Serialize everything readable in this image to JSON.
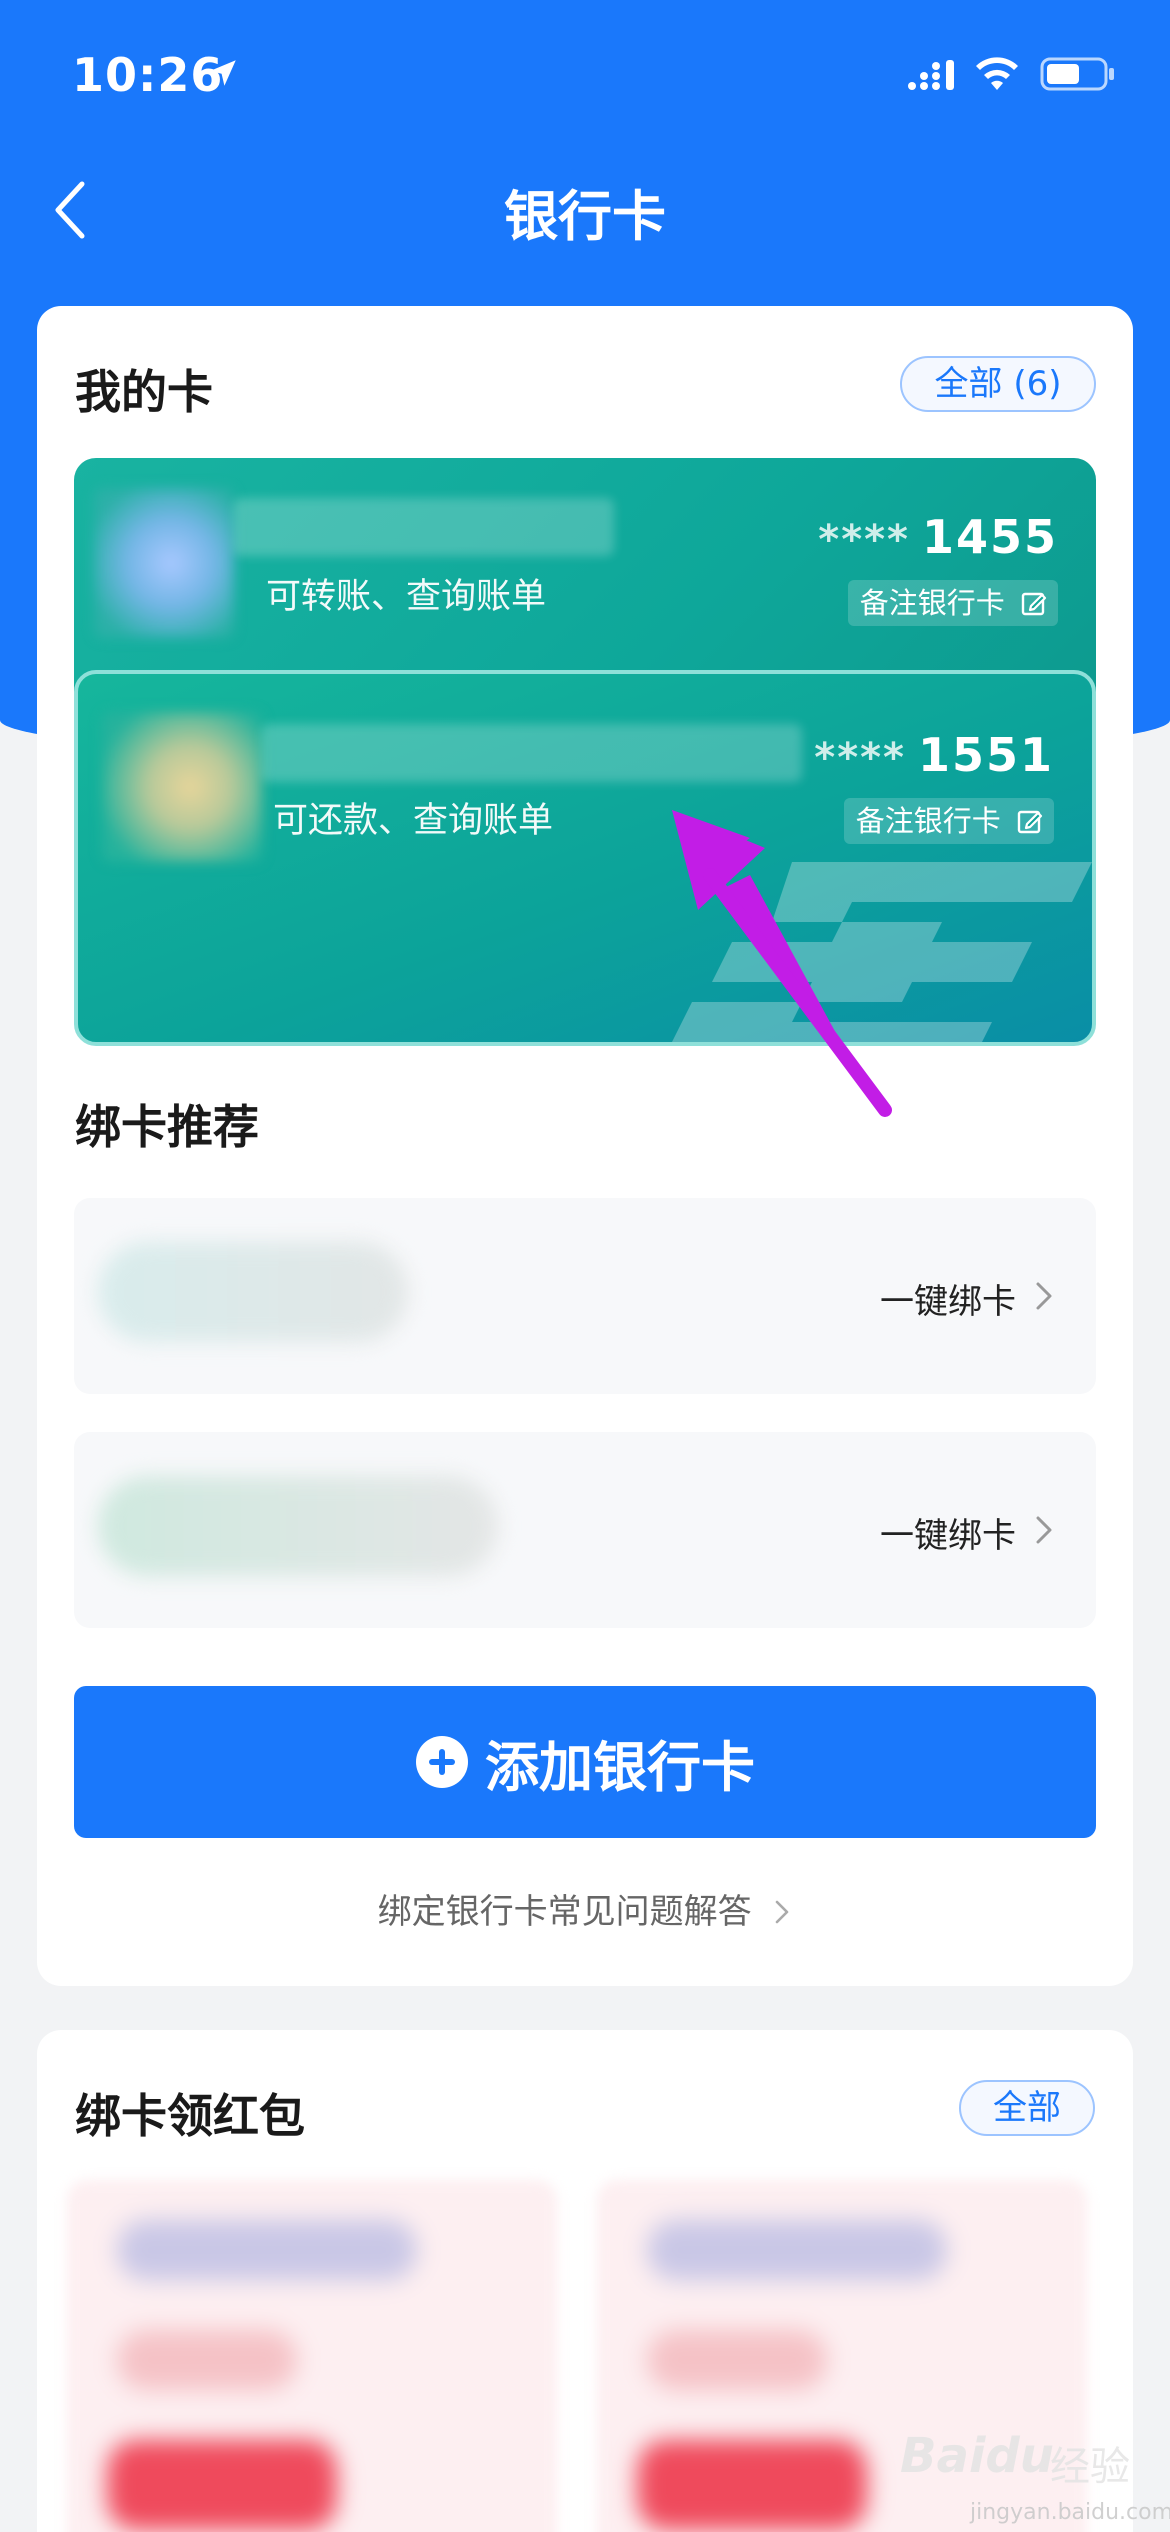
{
  "status_bar": {
    "time": "10:26"
  },
  "nav": {
    "title": "银行卡"
  },
  "my_cards": {
    "title": "我的卡",
    "all_button": "全部 (6)",
    "cards": [
      {
        "description": "可转账、查询账单",
        "mask": "****",
        "last4": "1455",
        "remark_label": "备注银行卡",
        "theme_color": "#14ad9d"
      },
      {
        "description": "可还款、查询账单",
        "mask": "****",
        "last4": "1551",
        "remark_label": "备注银行卡",
        "theme_color": "#0ca39a"
      }
    ]
  },
  "recommend": {
    "title": "绑卡推荐",
    "items": [
      {
        "action": "一键绑卡"
      },
      {
        "action": "一键绑卡"
      }
    ]
  },
  "add_card": {
    "label": "添加银行卡"
  },
  "faq": {
    "label": "绑定银行卡常见问题解答"
  },
  "redpack": {
    "title": "绑卡领红包",
    "all_button": "全部"
  },
  "watermark": {
    "brand": "Baidu",
    "brand_cn": "经验",
    "site": "jingyan.baidu.com"
  },
  "colors": {
    "primary": "#1a78fb",
    "annotation_arrow": "#c21de6"
  }
}
